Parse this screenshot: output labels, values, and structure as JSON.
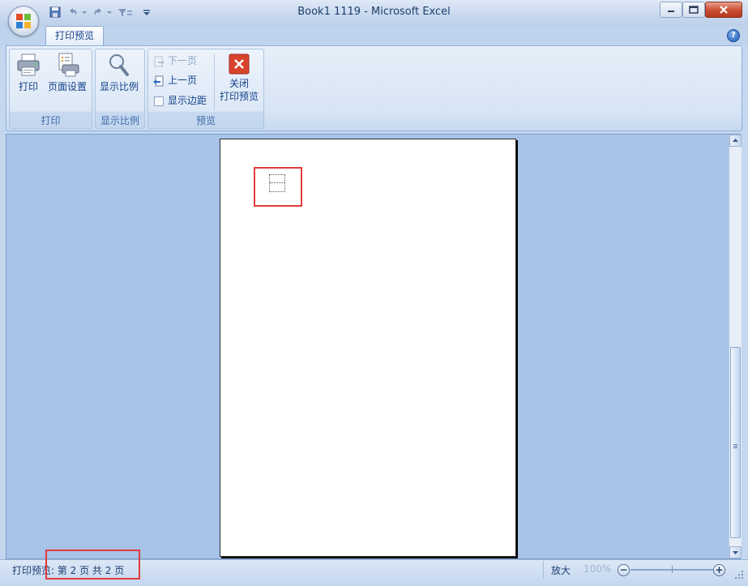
{
  "window": {
    "title": "Book1 1119 - Microsoft Excel"
  },
  "quick_access": {
    "icons": [
      "save-icon",
      "undo-icon",
      "redo-icon",
      "customize-icon"
    ]
  },
  "ribbon": {
    "tab": "打印预览",
    "groups": {
      "print": {
        "label": "打印",
        "print_label": "打印",
        "page_setup_label": "页面设置"
      },
      "zoom": {
        "label": "显示比例",
        "zoom_label": "显示比例"
      },
      "preview": {
        "label": "预览",
        "next_page_label": "下一页",
        "prev_page_label": "上一页",
        "show_margins_label": "显示边距",
        "close_label_line1": "关闭",
        "close_label_line2": "打印预览"
      }
    }
  },
  "statusbar": {
    "text": "打印预览: 第 2 页  共 2 页",
    "zoom_label": "放大",
    "zoom_value": "100%",
    "zoom_minus": "−",
    "zoom_plus": "+"
  },
  "colors": {
    "accent": "#15428b",
    "workspace": "#a7c3e8",
    "highlight": "#e23b3b"
  }
}
